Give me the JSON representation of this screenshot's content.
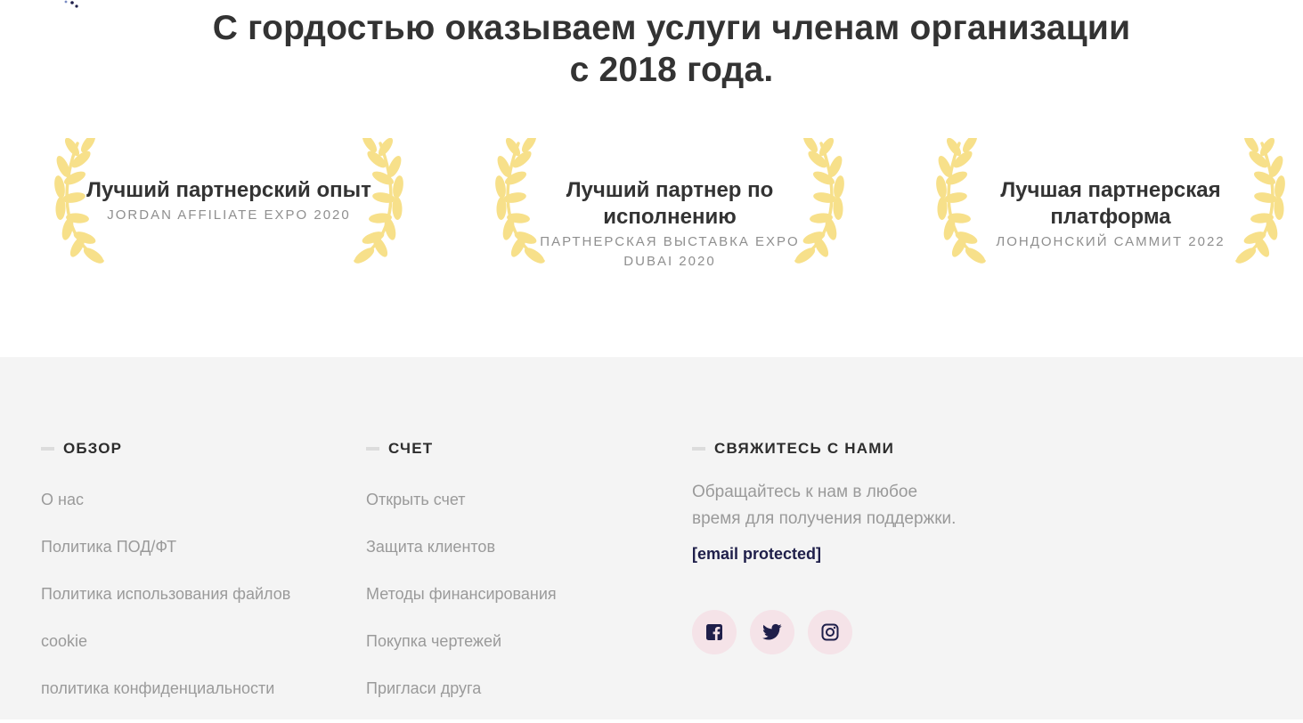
{
  "hero": {
    "title_line1": "С гордостью оказываем услуги членам организации",
    "title_line2": "с 2018 года."
  },
  "awards": [
    {
      "title": "Лучший партнерский опыт",
      "event": "JORDAN AFFILIATE EXPO 2020"
    },
    {
      "title": "Лучший партнер по исполнению",
      "event": "ПАРТНЕРСКАЯ ВЫСТАВКА EXPO DUBAI 2020"
    },
    {
      "title": "Лучшая партнерская платформа",
      "event": "ЛОНДОНСКИЙ САММИТ 2022"
    }
  ],
  "footer": {
    "overview": {
      "heading": "ОБЗОР",
      "links": [
        "О нас",
        "Политика ПОД/ФТ",
        "Политика использования файлов",
        "cookie",
        "политика конфиденциальности"
      ]
    },
    "account": {
      "heading": "СЧЕТ",
      "links": [
        "Открыть счет",
        "Защита клиентов",
        "Методы финансирования",
        "Покупка чертежей",
        "Пригласи друга"
      ]
    },
    "contact": {
      "heading": "СВЯЖИТЕСЬ С НАМИ",
      "text_line1": "Обращайтесь к нам в любое",
      "text_line2": "время для получения поддержки.",
      "email": "[email protected]",
      "socials": [
        {
          "name": "facebook",
          "icon": "facebook-icon"
        },
        {
          "name": "twitter",
          "icon": "twitter-icon"
        },
        {
          "name": "instagram",
          "icon": "instagram-icon"
        }
      ]
    }
  },
  "colors": {
    "laurel": "#f7e08a",
    "footer_bg": "#f4f4f4",
    "social_bg": "#f5e3e8",
    "social_icon": "#1f1f4a",
    "heading_text": "#333333",
    "link_text": "#9a9a9a"
  }
}
